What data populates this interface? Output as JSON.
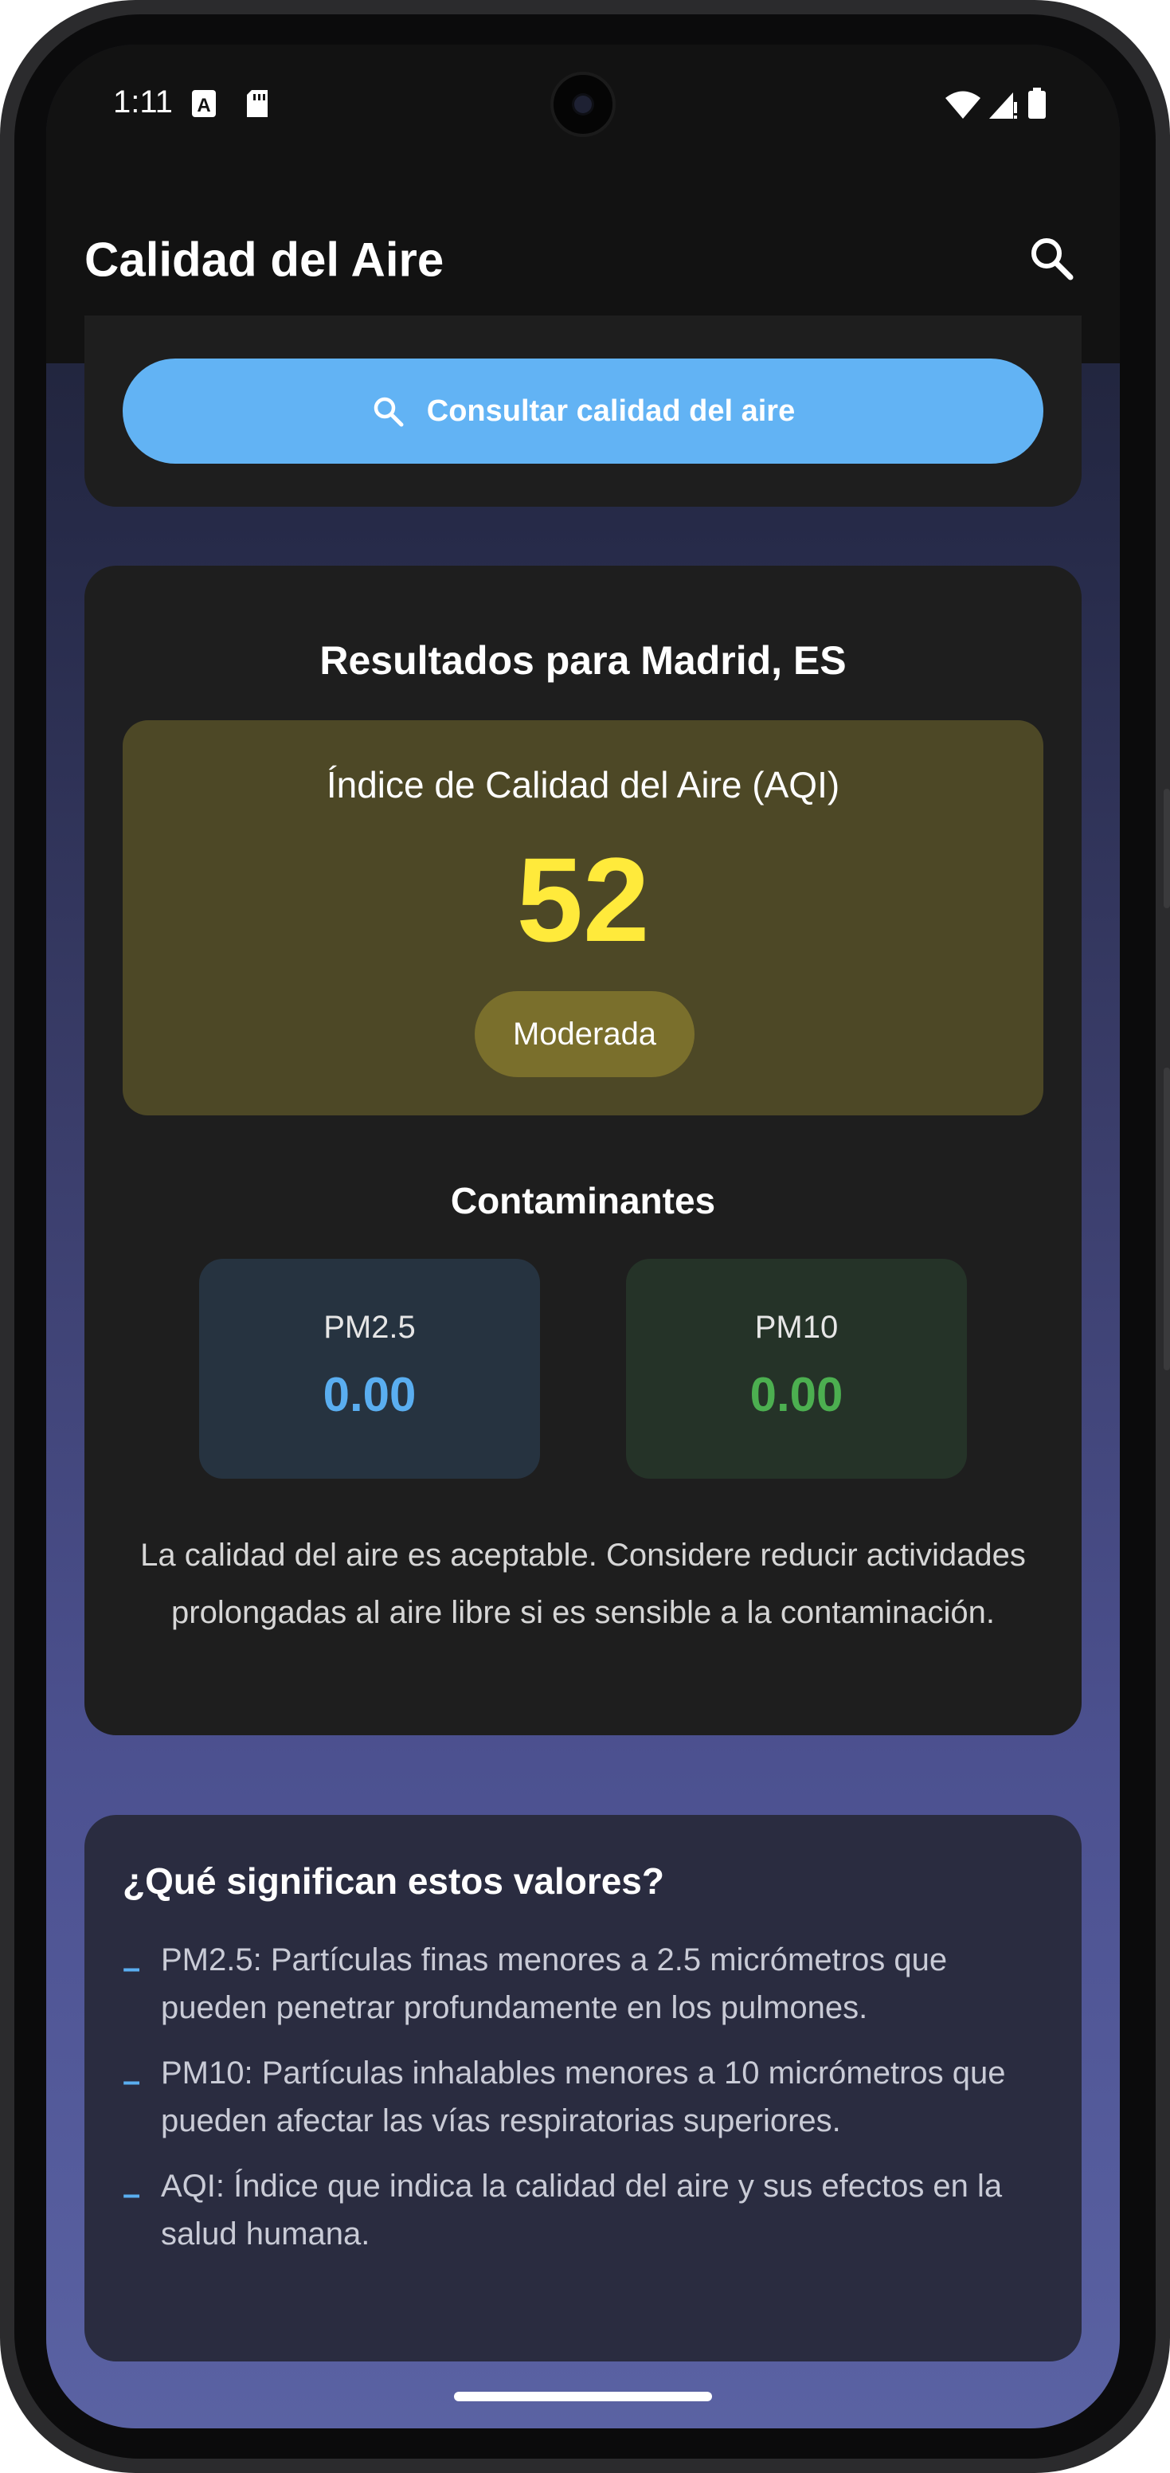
{
  "status_bar": {
    "time": "1:11"
  },
  "app_bar": {
    "title": "Calidad del Aire"
  },
  "query": {
    "button_label": "Consultar calidad del aire"
  },
  "results": {
    "title": "Resultados para Madrid, ES",
    "aqi_label": "Índice de Calidad del Aire (AQI)",
    "aqi_value": "52",
    "aqi_category": "Moderada",
    "pollutants_title": "Contaminantes",
    "pollutants": [
      {
        "name": "PM2.5",
        "value": "0.00"
      },
      {
        "name": "PM10",
        "value": "0.00"
      }
    ],
    "advice": "La calidad del aire es aceptable. Considere reducir actividades prolongadas al aire libre si es sensible a la contaminación."
  },
  "info": {
    "title": "¿Qué significan estos valores?",
    "items": [
      "PM2.5: Partículas finas menores a 2.5 micrómetros que pueden penetrar profundamente en los pulmones.",
      "PM10: Partículas inhalables menores a 10 micrómetros que pueden afectar las vías respiratorias superiores.",
      "AQI: Índice que indica la calidad del aire y sus efectos en la salud humana."
    ]
  },
  "colors": {
    "accent_blue": "#62b3f4",
    "aqi_yellow": "#ffea3b",
    "pm25_color": "#5aaef0",
    "pm10_color": "#4caf50",
    "card_bg": "#1e1e1e"
  },
  "icons": {
    "search": "search-icon",
    "wifi": "wifi-icon",
    "signal": "signal-icon",
    "battery": "battery-icon",
    "sim": "sim-card-icon",
    "keyboard": "a-icon"
  }
}
